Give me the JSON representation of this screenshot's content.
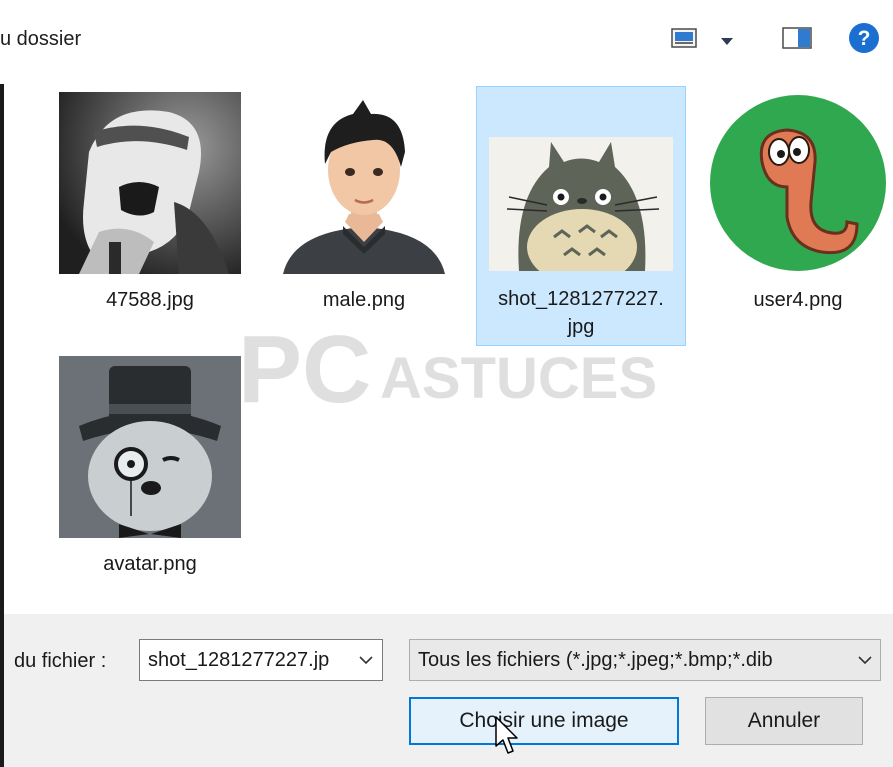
{
  "toolbar": {
    "title": "u dossier",
    "view_icon": "thumbnail-view-icon",
    "dropdown_icon": "chevron-down-icon",
    "pane_icon": "preview-pane-icon",
    "help_label": "?"
  },
  "files": [
    {
      "name": "47588.jpg",
      "selected": false
    },
    {
      "name": "male.png",
      "selected": false
    },
    {
      "name": "shot_1281277227.jpg",
      "selected": true,
      "line1": "shot_1281277227.",
      "line2": "jpg"
    },
    {
      "name": "user4.png",
      "selected": false
    },
    {
      "name": "avatar.png",
      "selected": false
    }
  ],
  "watermark": {
    "text_pc": "PC",
    "text_rest": "ASTUCES"
  },
  "bottom": {
    "filename_label": "du fichier :",
    "filename_value": "shot_1281277227.jp",
    "filter_value": "Tous les fichiers (*.jpg;*.jpeg;*.bmp;*.dib",
    "open_label": "Choisir une image",
    "cancel_label": "Annuler"
  },
  "colors": {
    "selection": "#cce8ff",
    "selection_border": "#99d1ff",
    "accent": "#0078d7",
    "help": "#1a6fd1"
  }
}
